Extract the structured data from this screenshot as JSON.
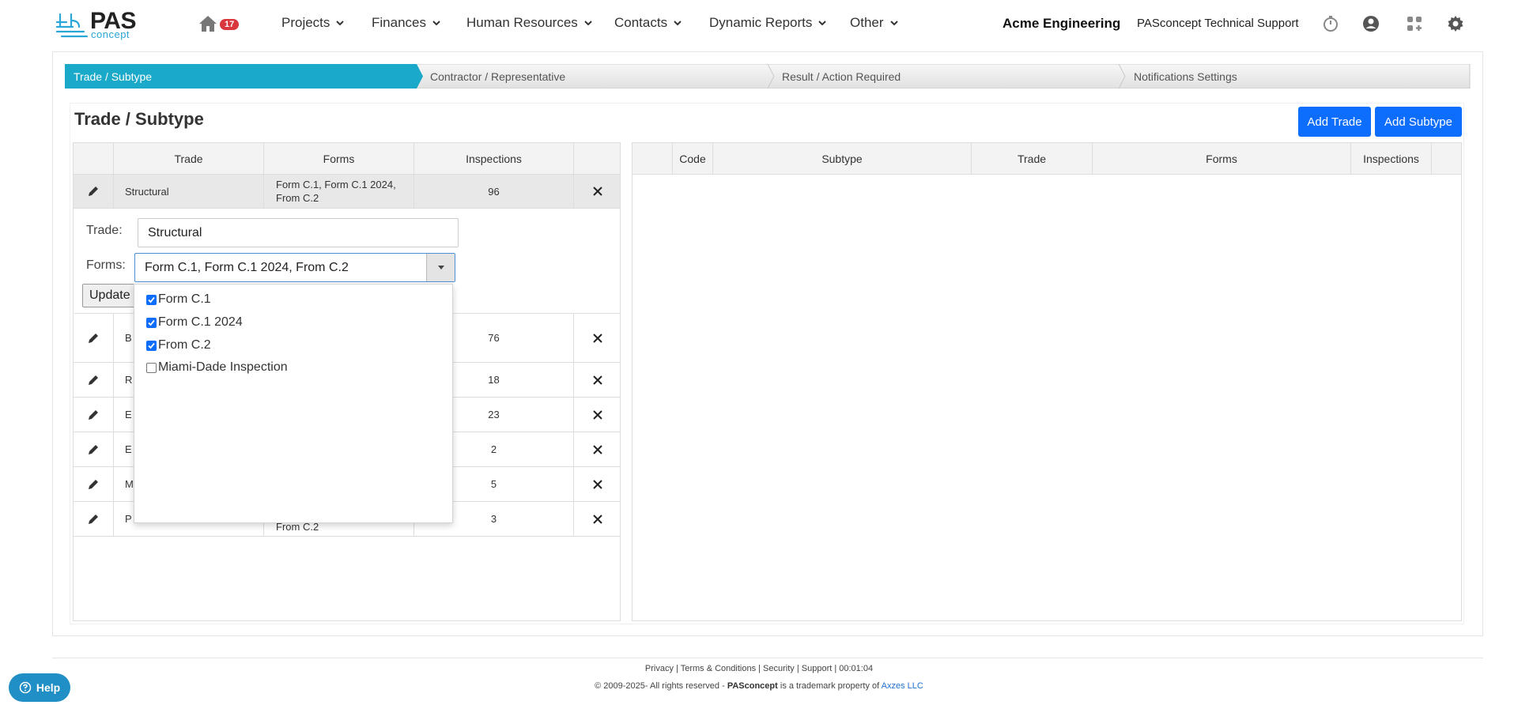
{
  "header": {
    "logo_main": "PAS",
    "logo_sub": "concept",
    "notification_count": "17",
    "nav": [
      "Projects",
      "Finances",
      "Human Resources",
      "Contacts",
      "Dynamic Reports",
      "Other"
    ],
    "company": "Acme Engineering",
    "support_user": "PASconcept Technical Support",
    "icons": [
      "timer-icon",
      "user-icon",
      "apps-icon",
      "settings-icon"
    ]
  },
  "steps": [
    "Trade / Subtype",
    "Contractor / Representative",
    "Result / Action Required",
    "Notifications Settings"
  ],
  "page": {
    "title": "Trade / Subtype",
    "add_trade": "Add Trade",
    "add_subtype": "Add Subtype"
  },
  "trades_grid": {
    "columns": [
      "",
      "Trade",
      "Forms",
      "Inspections",
      ""
    ],
    "rows": [
      {
        "trade": "Structural",
        "forms": "Form C.1, Form C.1 2024, From C.2",
        "inspections": "96"
      },
      {
        "trade": "B",
        "forms": "",
        "inspections": "76"
      },
      {
        "trade": "R",
        "forms": "",
        "inspections": "18"
      },
      {
        "trade": "E",
        "forms": "",
        "inspections": "23"
      },
      {
        "trade": "E",
        "forms": "",
        "inspections": "2"
      },
      {
        "trade": "M",
        "forms": "",
        "inspections": "5"
      },
      {
        "trade": "P",
        "forms": "From C.2",
        "inspections": "3"
      }
    ]
  },
  "edit_form": {
    "trade_label": "Trade:",
    "trade_value": "Structural",
    "forms_label": "Forms:",
    "forms_value": "Form C.1, Form C.1 2024, From C.2",
    "update_label": "Update"
  },
  "forms_options": [
    {
      "label": "Form C.1",
      "checked": true
    },
    {
      "label": "Form C.1 2024",
      "checked": true
    },
    {
      "label": "From C.2",
      "checked": true
    },
    {
      "label": "Miami-Dade Inspection",
      "checked": false
    }
  ],
  "subtype_grid": {
    "columns": [
      "",
      "Code",
      "Subtype",
      "Trade",
      "Forms",
      "Inspections",
      ""
    ]
  },
  "footer": {
    "links": "Privacy | Terms & Conditions | Security | Support | 00:01:04",
    "copyright": "© 2009-2025- All rights reserved -",
    "brand": "PASconcept",
    "trademark": "is a trademark property of",
    "company_link": "Axzes LLC"
  },
  "help_label": "Help",
  "colors": {
    "active_step": "#1ba9c9",
    "primary_button": "#0d6efd",
    "badge": "#d9363e",
    "help_button": "#1f8fc6"
  }
}
